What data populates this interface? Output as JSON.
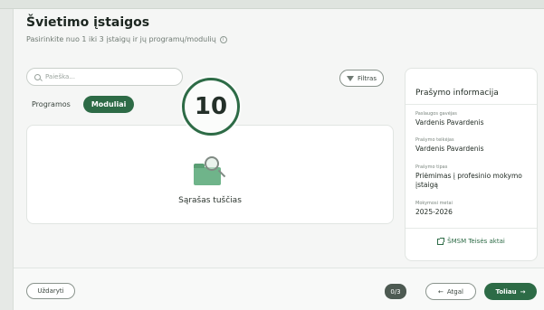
{
  "header": {
    "title": "Švietimo įstaigos",
    "subtitle": "Pasirinkite nuo 1 iki 3 įstaigų ir jų programų/modulių"
  },
  "search": {
    "placeholder": "Paieška..."
  },
  "filter": {
    "label": "Filtras"
  },
  "tabs": [
    {
      "label": "Programos",
      "active": false
    },
    {
      "label": "Moduliai",
      "active": true
    }
  ],
  "step_badge": "10",
  "list": {
    "empty_text": "Sąrašas tuščias"
  },
  "info_panel": {
    "title": "Prašymo informacija",
    "fields": [
      {
        "label": "Paslaugos gavėjas",
        "value": "Vardenis Pavardenis"
      },
      {
        "label": "Prašymo teikėjas",
        "value": "Vardenis Pavardenis"
      },
      {
        "label": "Prašymo tipas",
        "value": "Priėmimas į profesinio mokymo įstaigą"
      },
      {
        "label": "Mokymosi metai",
        "value": "2025-2026"
      }
    ],
    "legal_link": "ŠMSM Teisės aktai"
  },
  "footer": {
    "close_label": "Uždaryti",
    "counter": "0/3",
    "back_label": "Atgal",
    "next_label": "Toliau"
  },
  "colors": {
    "primary": "#2d6b46",
    "counter_bg": "#4d5a52"
  },
  "icons": [
    "info-icon",
    "search-icon",
    "filter-icon",
    "empty-folder-icon",
    "external-link-icon",
    "arrow-left-icon",
    "arrow-right-icon"
  ]
}
